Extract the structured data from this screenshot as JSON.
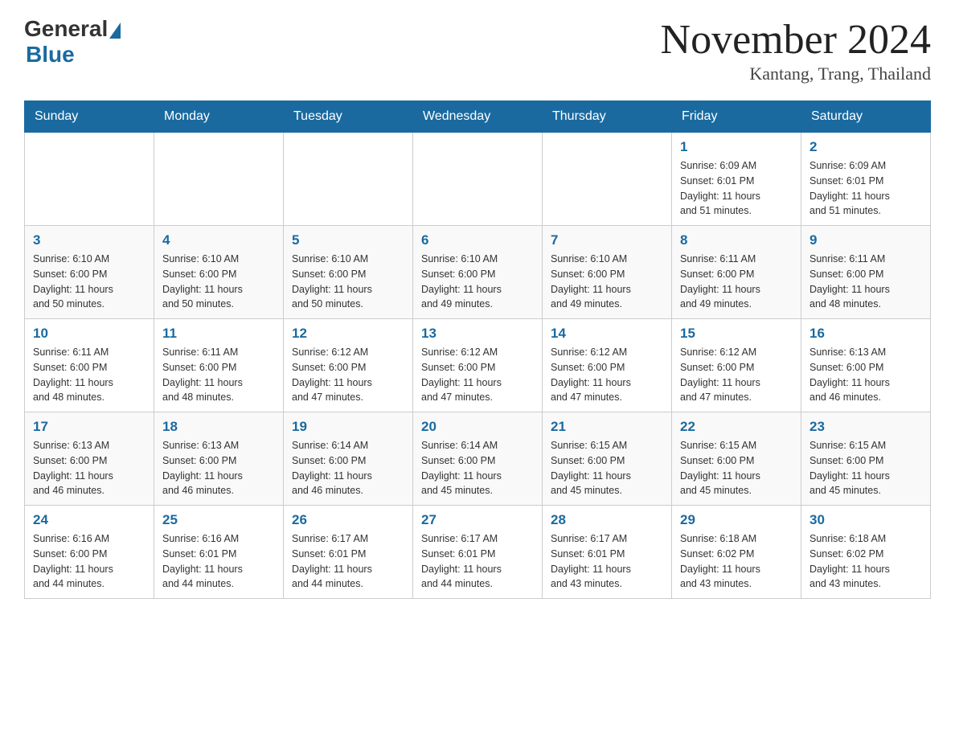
{
  "header": {
    "logo_general": "General",
    "logo_blue": "Blue",
    "month_year": "November 2024",
    "location": "Kantang, Trang, Thailand"
  },
  "days_of_week": [
    "Sunday",
    "Monday",
    "Tuesday",
    "Wednesday",
    "Thursday",
    "Friday",
    "Saturday"
  ],
  "weeks": [
    [
      {
        "day": "",
        "info": ""
      },
      {
        "day": "",
        "info": ""
      },
      {
        "day": "",
        "info": ""
      },
      {
        "day": "",
        "info": ""
      },
      {
        "day": "",
        "info": ""
      },
      {
        "day": "1",
        "info": "Sunrise: 6:09 AM\nSunset: 6:01 PM\nDaylight: 11 hours\nand 51 minutes."
      },
      {
        "day": "2",
        "info": "Sunrise: 6:09 AM\nSunset: 6:01 PM\nDaylight: 11 hours\nand 51 minutes."
      }
    ],
    [
      {
        "day": "3",
        "info": "Sunrise: 6:10 AM\nSunset: 6:00 PM\nDaylight: 11 hours\nand 50 minutes."
      },
      {
        "day": "4",
        "info": "Sunrise: 6:10 AM\nSunset: 6:00 PM\nDaylight: 11 hours\nand 50 minutes."
      },
      {
        "day": "5",
        "info": "Sunrise: 6:10 AM\nSunset: 6:00 PM\nDaylight: 11 hours\nand 50 minutes."
      },
      {
        "day": "6",
        "info": "Sunrise: 6:10 AM\nSunset: 6:00 PM\nDaylight: 11 hours\nand 49 minutes."
      },
      {
        "day": "7",
        "info": "Sunrise: 6:10 AM\nSunset: 6:00 PM\nDaylight: 11 hours\nand 49 minutes."
      },
      {
        "day": "8",
        "info": "Sunrise: 6:11 AM\nSunset: 6:00 PM\nDaylight: 11 hours\nand 49 minutes."
      },
      {
        "day": "9",
        "info": "Sunrise: 6:11 AM\nSunset: 6:00 PM\nDaylight: 11 hours\nand 48 minutes."
      }
    ],
    [
      {
        "day": "10",
        "info": "Sunrise: 6:11 AM\nSunset: 6:00 PM\nDaylight: 11 hours\nand 48 minutes."
      },
      {
        "day": "11",
        "info": "Sunrise: 6:11 AM\nSunset: 6:00 PM\nDaylight: 11 hours\nand 48 minutes."
      },
      {
        "day": "12",
        "info": "Sunrise: 6:12 AM\nSunset: 6:00 PM\nDaylight: 11 hours\nand 47 minutes."
      },
      {
        "day": "13",
        "info": "Sunrise: 6:12 AM\nSunset: 6:00 PM\nDaylight: 11 hours\nand 47 minutes."
      },
      {
        "day": "14",
        "info": "Sunrise: 6:12 AM\nSunset: 6:00 PM\nDaylight: 11 hours\nand 47 minutes."
      },
      {
        "day": "15",
        "info": "Sunrise: 6:12 AM\nSunset: 6:00 PM\nDaylight: 11 hours\nand 47 minutes."
      },
      {
        "day": "16",
        "info": "Sunrise: 6:13 AM\nSunset: 6:00 PM\nDaylight: 11 hours\nand 46 minutes."
      }
    ],
    [
      {
        "day": "17",
        "info": "Sunrise: 6:13 AM\nSunset: 6:00 PM\nDaylight: 11 hours\nand 46 minutes."
      },
      {
        "day": "18",
        "info": "Sunrise: 6:13 AM\nSunset: 6:00 PM\nDaylight: 11 hours\nand 46 minutes."
      },
      {
        "day": "19",
        "info": "Sunrise: 6:14 AM\nSunset: 6:00 PM\nDaylight: 11 hours\nand 46 minutes."
      },
      {
        "day": "20",
        "info": "Sunrise: 6:14 AM\nSunset: 6:00 PM\nDaylight: 11 hours\nand 45 minutes."
      },
      {
        "day": "21",
        "info": "Sunrise: 6:15 AM\nSunset: 6:00 PM\nDaylight: 11 hours\nand 45 minutes."
      },
      {
        "day": "22",
        "info": "Sunrise: 6:15 AM\nSunset: 6:00 PM\nDaylight: 11 hours\nand 45 minutes."
      },
      {
        "day": "23",
        "info": "Sunrise: 6:15 AM\nSunset: 6:00 PM\nDaylight: 11 hours\nand 45 minutes."
      }
    ],
    [
      {
        "day": "24",
        "info": "Sunrise: 6:16 AM\nSunset: 6:00 PM\nDaylight: 11 hours\nand 44 minutes."
      },
      {
        "day": "25",
        "info": "Sunrise: 6:16 AM\nSunset: 6:01 PM\nDaylight: 11 hours\nand 44 minutes."
      },
      {
        "day": "26",
        "info": "Sunrise: 6:17 AM\nSunset: 6:01 PM\nDaylight: 11 hours\nand 44 minutes."
      },
      {
        "day": "27",
        "info": "Sunrise: 6:17 AM\nSunset: 6:01 PM\nDaylight: 11 hours\nand 44 minutes."
      },
      {
        "day": "28",
        "info": "Sunrise: 6:17 AM\nSunset: 6:01 PM\nDaylight: 11 hours\nand 43 minutes."
      },
      {
        "day": "29",
        "info": "Sunrise: 6:18 AM\nSunset: 6:02 PM\nDaylight: 11 hours\nand 43 minutes."
      },
      {
        "day": "30",
        "info": "Sunrise: 6:18 AM\nSunset: 6:02 PM\nDaylight: 11 hours\nand 43 minutes."
      }
    ]
  ]
}
